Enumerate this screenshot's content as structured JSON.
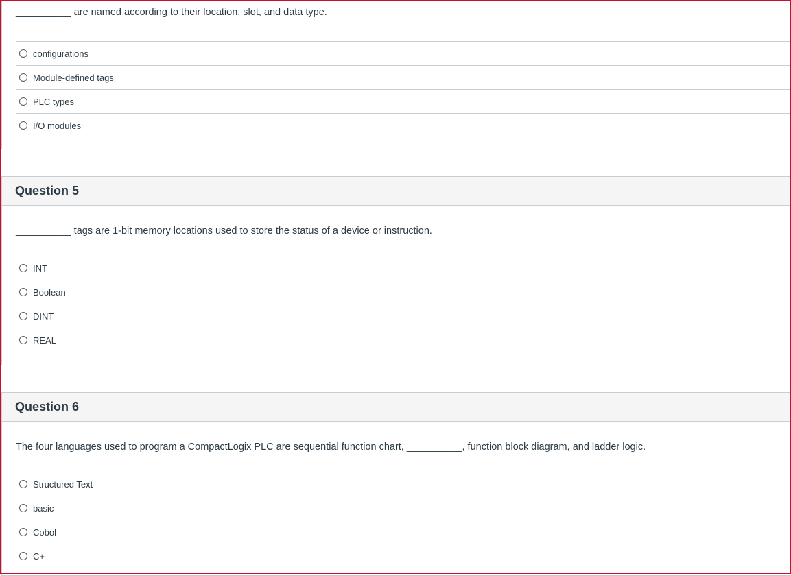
{
  "questions": [
    {
      "number_label": "",
      "text": "__________ are named according to their location, slot, and data type.",
      "answers": [
        "configurations",
        "Module-defined tags",
        "PLC types",
        "I/O modules"
      ]
    },
    {
      "number_label": "Question 5",
      "text": "__________ tags are 1-bit memory locations used to store the status of a device or instruction.",
      "answers": [
        "INT",
        "Boolean",
        "DINT",
        "REAL"
      ]
    },
    {
      "number_label": "Question 6",
      "text": "The four languages used to program a CompactLogix PLC are sequential function chart, __________, function block diagram, and ladder logic.",
      "answers": [
        "Structured Text",
        "basic",
        "Cobol",
        "C+"
      ]
    }
  ]
}
